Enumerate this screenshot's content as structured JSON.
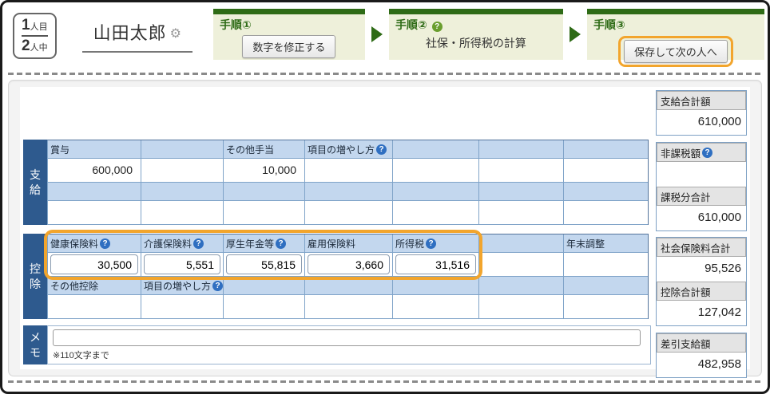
{
  "icons": {
    "help": "?",
    "gear": "⚙"
  },
  "header": {
    "counter": {
      "current": "1",
      "current_unit": "人目",
      "total": "2",
      "total_unit": "人中"
    },
    "employee_name": "山田太郎",
    "steps": [
      {
        "title": "手順①",
        "button": "数字を修正する"
      },
      {
        "title": "手順②",
        "text": "社保・所得税の計算"
      },
      {
        "title": "手順③",
        "button": "保存して次の人へ"
      }
    ]
  },
  "payment": {
    "label": "支給",
    "h1": [
      "賞与",
      "",
      "その他手当",
      "項目の増やし方",
      "",
      "",
      ""
    ],
    "v1": [
      "600,000",
      "",
      "10,000",
      "",
      "",
      "",
      ""
    ],
    "h2": [
      "",
      "",
      "",
      "",
      "",
      "",
      ""
    ],
    "v2": [
      "",
      "",
      "",
      "",
      "",
      "",
      ""
    ]
  },
  "deductions": {
    "label": "控除",
    "h1": [
      "健康保険料",
      "介護保険料",
      "厚生年金等",
      "雇用保険料",
      "所得税",
      "",
      "年末調整"
    ],
    "inputs": [
      "30,500",
      "5,551",
      "55,815",
      "3,660",
      "31,516"
    ],
    "h2": [
      "その他控除",
      "項目の増やし方",
      "",
      "",
      "",
      "",
      ""
    ],
    "v2": [
      "",
      "",
      "",
      "",
      "",
      "",
      ""
    ]
  },
  "memo": {
    "label": "メモ",
    "value": "",
    "note": "※110文字まで"
  },
  "summary": {
    "total_payment": {
      "label": "支給合計額",
      "value": "610,000"
    },
    "tax_free": {
      "label": "非課税額",
      "value": ""
    },
    "taxable_total": {
      "label": "課税分合計",
      "value": "610,000"
    },
    "social_insurance_total": {
      "label": "社会保険料合計",
      "value": "95,526"
    },
    "deduction_total": {
      "label": "控除合計額",
      "value": "127,042"
    },
    "net_payment": {
      "label": "差引支給額",
      "value": "482,958"
    }
  },
  "colors": {
    "accent_orange": "#F2A52D",
    "step_green": "#2E6B16",
    "step_bg": "#EEF0DA",
    "row_label_blue": "#2E5A8E",
    "table_header_blue": "#C3D7EE",
    "table_border_blue": "#54749C",
    "help_blue": "#2F6FC1",
    "help_green": "#6A9E2E",
    "summary_header_gray": "#E4E4E4"
  }
}
